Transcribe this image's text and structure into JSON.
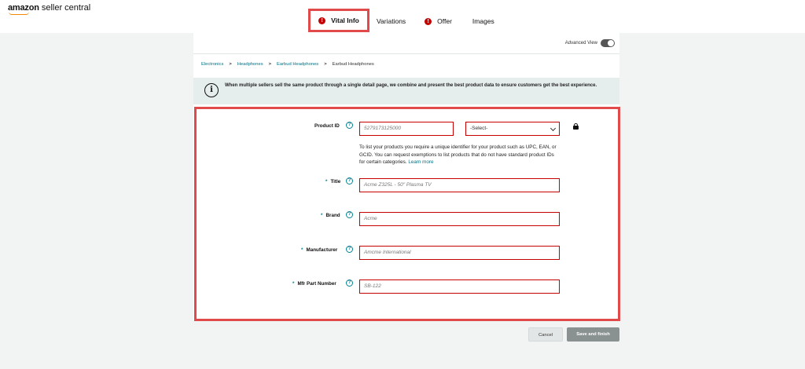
{
  "brand": {
    "name_bold": "amazon",
    "name_rest": " seller central"
  },
  "tabs": [
    {
      "label": "Vital Info",
      "alert": "!"
    },
    {
      "label": "Variations"
    },
    {
      "label": "Offer",
      "alert": "!"
    },
    {
      "label": "Images"
    }
  ],
  "advanced_view": {
    "label": "Advanced View"
  },
  "breadcrumb": {
    "items": [
      "Electronics",
      "Headphones",
      "Earbud Headphones",
      "Earbud Headphones"
    ],
    "sep": ">"
  },
  "info": {
    "icon": "i",
    "text": "When multiple sellers sell the same product through a single detail page, we combine and present the best product data to ensure customers get the best experience."
  },
  "form": {
    "help_glyph": "?",
    "required_mark": "*",
    "product_id": {
      "label": "Product ID",
      "placeholder": "5279173125000",
      "select_value": "-Select-"
    },
    "hint": {
      "text": "To list your products you require a unique identifier for your product such as UPC, EAN, or GCID. You can request exemptions to list products that do not have standard product IDs for certain categories. ",
      "link": "Learn more"
    },
    "title": {
      "label": "Title",
      "placeholder": "Acme Z325L - 50\" Plasma TV"
    },
    "brand": {
      "label": "Brand",
      "placeholder": "Acme"
    },
    "manufacturer": {
      "label": "Manufacturer",
      "placeholder": "Amcme International"
    },
    "mfr_part": {
      "label": "Mfr Part Number",
      "placeholder": "SB-122"
    }
  },
  "buttons": {
    "cancel": "Cancel",
    "save": "Save and finish"
  },
  "colors": {
    "highlight": "#e14a4a",
    "error_border": "#c40000",
    "link": "#007185",
    "info_bg": "#e6eded",
    "save_btn": "#8a9191"
  }
}
